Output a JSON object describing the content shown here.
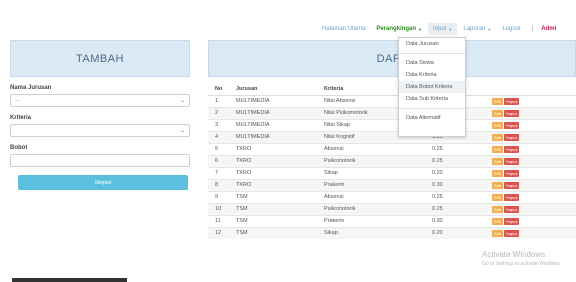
{
  "nav": {
    "items": [
      "Halaman Utama",
      "Perangkingan",
      "Input",
      "Laporan",
      "Logout"
    ],
    "separator": "|",
    "admin": "Admi"
  },
  "dropdown": {
    "items": [
      "Data Jurusan",
      "Data Siswa",
      "Data Kriteria",
      "Data Bobot Kriteria",
      "Data Sub Kriteria",
      "Data Alternatif"
    ],
    "highlighted": "Data Bobot Kriteria"
  },
  "left": {
    "title": "TAMBAH",
    "jurusan_label": "Nama Jurusan",
    "jurusan_value": "---",
    "kriteria_label": "Kriteria",
    "kriteria_value": "",
    "bobot_label": "Bobot",
    "bobot_value": "",
    "save_label": "Simpan"
  },
  "right": {
    "title": "DAFT",
    "columns": [
      "No",
      "Jurusan",
      "Kriteria",
      ""
    ],
    "edit_label": "Edit",
    "delete_label": "Hapus",
    "rows": [
      {
        "no": "1",
        "jurusan": "MULTIMEDIA",
        "kriteria": "Nilai Absensi",
        "bobot": ""
      },
      {
        "no": "2",
        "jurusan": "MULTIMEDIA",
        "kriteria": "Nilai Psikomotorik",
        "bobot": ""
      },
      {
        "no": "3",
        "jurusan": "MULTIMEDIA",
        "kriteria": "Nilai Sikap",
        "bobot": "0.20"
      },
      {
        "no": "4",
        "jurusan": "MULTIMEDIA",
        "kriteria": "Nilai Kognitif",
        "bobot": "0.30"
      },
      {
        "no": "5",
        "jurusan": "TKRO",
        "kriteria": "Absensi",
        "bobot": "0.25"
      },
      {
        "no": "6",
        "jurusan": "TKRO",
        "kriteria": "Psikomotorik",
        "bobot": "0.25"
      },
      {
        "no": "7",
        "jurusan": "TKRO",
        "kriteria": "Sikap",
        "bobot": "0.20"
      },
      {
        "no": "8",
        "jurusan": "TKRO",
        "kriteria": "Prakerin",
        "bobot": "0.30"
      },
      {
        "no": "9",
        "jurusan": "TSM",
        "kriteria": "Absensi",
        "bobot": "0.25"
      },
      {
        "no": "10",
        "jurusan": "TSM",
        "kriteria": "Psikomotorik",
        "bobot": "0.25"
      },
      {
        "no": "11",
        "jurusan": "TSM",
        "kriteria": "Prakerin",
        "bobot": "0.30"
      },
      {
        "no": "12",
        "jurusan": "TSM",
        "kriteria": "Sikap",
        "bobot": "0.20"
      }
    ]
  },
  "watermark": {
    "title": "Activate Windows",
    "subtitle": "Go to Settings to activate Windows."
  }
}
